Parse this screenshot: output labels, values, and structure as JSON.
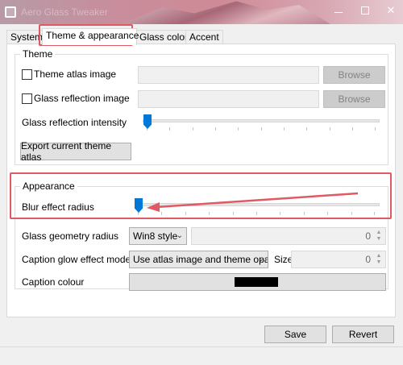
{
  "window": {
    "title": "Aero Glass Tweaker",
    "close_glyph": "✕"
  },
  "tabs": [
    {
      "label": "System"
    },
    {
      "label": "Theme & appearance"
    },
    {
      "label": "Glass colors"
    },
    {
      "label": "Accent"
    }
  ],
  "theme": {
    "title": "Theme",
    "atlas_label": "Theme atlas image",
    "reflection_label": "Glass reflection image",
    "browse_label": "Browse",
    "intensity_label": "Glass reflection intensity",
    "intensity_value": 0.0,
    "export_label": "Export current theme atlas"
  },
  "appearance": {
    "title": "Appearance",
    "blur_label": "Blur effect radius",
    "blur_value": 0.0,
    "geometry_label": "Glass geometry radius",
    "geometry_style": "Win8 style",
    "geometry_value": "0",
    "caption_glow_label": "Caption glow effect mode",
    "caption_glow_mode": "Use atlas image and theme opac",
    "size_label": "Size",
    "size_value": "0",
    "caption_colour_label": "Caption colour",
    "caption_colour": "#000000"
  },
  "footer": {
    "save_label": "Save",
    "revert_label": "Revert"
  },
  "colors": {
    "highlight": "#e05a63",
    "accent": "#0078d7"
  }
}
